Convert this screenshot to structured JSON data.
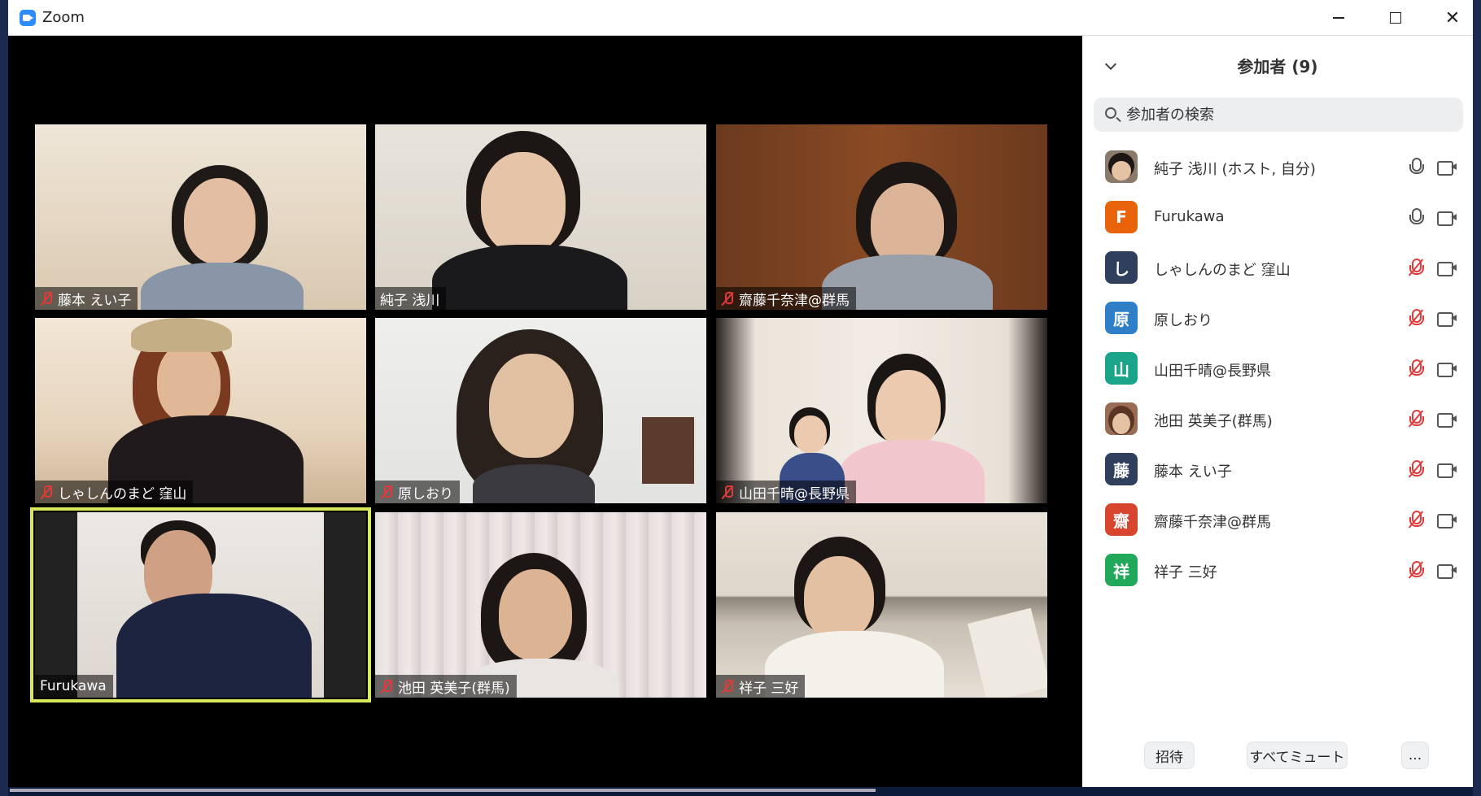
{
  "window": {
    "title": "Zoom"
  },
  "tiles": [
    {
      "name": "藤本 えい子",
      "muted": true
    },
    {
      "name": "純子 浅川",
      "muted": false
    },
    {
      "name": "齋藤千奈津@群馬",
      "muted": true
    },
    {
      "name": "しゃしんのまど 窪山",
      "muted": true
    },
    {
      "name": "原しおり",
      "muted": true
    },
    {
      "name": "山田千晴@長野県",
      "muted": true
    },
    {
      "name": "Furukawa",
      "muted": false,
      "active": true
    },
    {
      "name": "池田 英美子(群馬)",
      "muted": true
    },
    {
      "name": "祥子 三好",
      "muted": true
    }
  ],
  "panel": {
    "title": "参加者 (9)",
    "search_placeholder": "参加者の検索",
    "participants": [
      {
        "name": "純子 浅川 (ホスト, 自分)",
        "avatar": "",
        "color": "#8a7a6a",
        "muted": false
      },
      {
        "name": "Furukawa",
        "avatar": "F",
        "color": "#e8630a",
        "muted": false
      },
      {
        "name": "しゃしんのまど 窪山",
        "avatar": "し",
        "color": "#2f3f5c",
        "muted": true
      },
      {
        "name": "原しおり",
        "avatar": "原",
        "color": "#2f7fc8",
        "muted": true
      },
      {
        "name": "山田千晴@長野県",
        "avatar": "山",
        "color": "#1aa58a",
        "muted": true
      },
      {
        "name": "池田 英美子(群馬)",
        "avatar": "",
        "color": "#9a6b55",
        "muted": true
      },
      {
        "name": "藤本 えい子",
        "avatar": "藤",
        "color": "#2f3f5c",
        "muted": true
      },
      {
        "name": "齋藤千奈津@群馬",
        "avatar": "齋",
        "color": "#d8452f",
        "muted": true
      },
      {
        "name": "祥子 三好",
        "avatar": "祥",
        "color": "#22a85a",
        "muted": true
      }
    ],
    "invite_label": "招待",
    "mute_all_label": "すべてミュート",
    "more_label": "..."
  }
}
